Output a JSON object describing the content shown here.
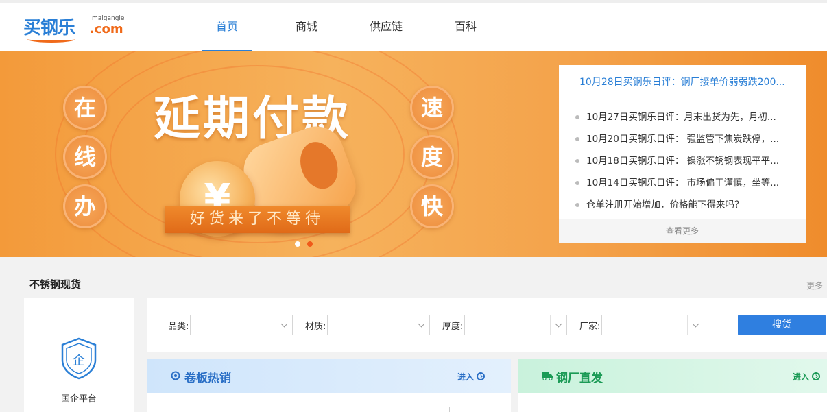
{
  "header": {
    "logo_cn": "买钢乐",
    "logo_en": "maigangle",
    "logo_com": ".com",
    "nav": [
      {
        "label": "首页",
        "active": true
      },
      {
        "label": "商城",
        "active": false
      },
      {
        "label": "供应链",
        "active": false
      },
      {
        "label": "百科",
        "active": false
      }
    ]
  },
  "banner": {
    "title": "延期付款",
    "left_chars": [
      "在",
      "线",
      "办"
    ],
    "right_chars": [
      "速",
      "度",
      "快"
    ],
    "coin_symbol": "¥",
    "ribbon": "好货来了不等待",
    "slide_count": 2,
    "active_slide": 2
  },
  "news": {
    "headline": "10月28日买钢乐日评：钢厂接单价弱弱跌200...",
    "items": [
      "10月27日买钢乐日评：月末出货为先，月初...",
      "10月20日买钢乐日评： 强监管下焦炭跌停，...",
      "10月18日买钢乐日评： 镍涨不锈钢表现平平...",
      "10月14日买钢乐日评： 市场偏于谨慎，坐等...",
      "仓单注册开始增加，价格能下得来吗？"
    ],
    "more": "查看更多"
  },
  "section": {
    "title": "不锈钢现货",
    "more": "更多"
  },
  "left_card": {
    "icon_char": "企",
    "label": "国企平台"
  },
  "filters": [
    {
      "label": "品类:",
      "value": ""
    },
    {
      "label": "材质:",
      "value": ""
    },
    {
      "label": "厚度:",
      "value": ""
    },
    {
      "label": "厂家:",
      "value": ""
    }
  ],
  "search_button": "搜货",
  "panels": [
    {
      "title": "卷板热销",
      "enter": "进入"
    },
    {
      "title": "钢厂直发",
      "enter": "进入"
    }
  ],
  "colors": {
    "brand_blue": "#2a7fd6",
    "brand_orange": "#f06a1a",
    "search_button": "#2f7fe0",
    "panel_green": "#1a9a55"
  }
}
